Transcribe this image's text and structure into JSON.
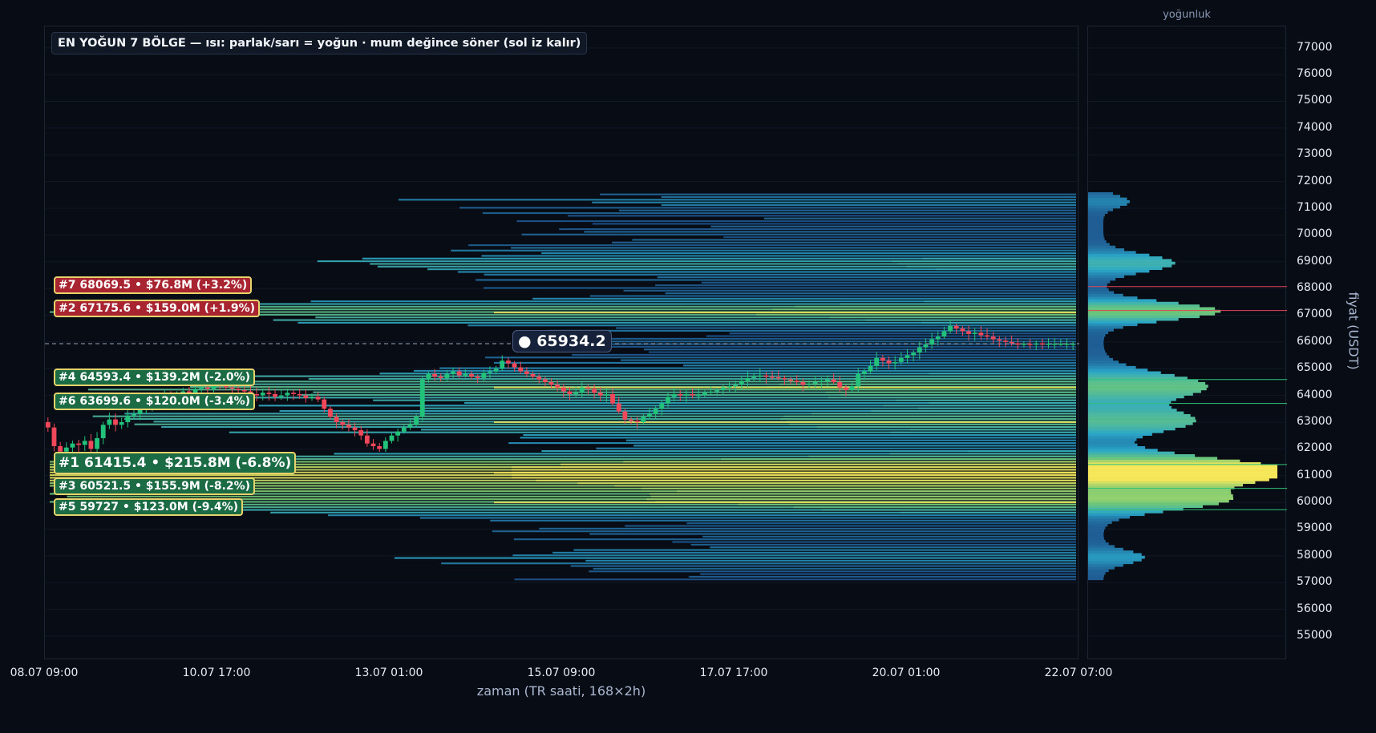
{
  "title": "EN YOĞUN 7 BÖLGE — ısı: parlak/sarı = yoğun · mum değince söner (sol iz kalır)",
  "current_price_label": "● 65934.2",
  "xlabel": "zaman (TR saati, 168×2h)",
  "ylabel": "fiyat (USDT)",
  "side_title": "yoğunluk",
  "x_ticks": [
    "08.07 09:00",
    "10.07 17:00",
    "13.07 01:00",
    "15.07 09:00",
    "17.07 17:00",
    "20.07 01:00",
    "22.07 07:00"
  ],
  "y_ticks": [
    "55000",
    "56000",
    "57000",
    "58000",
    "59000",
    "60000",
    "61000",
    "62000",
    "63000",
    "64000",
    "65000",
    "66000",
    "67000",
    "68000",
    "69000",
    "70000",
    "71000",
    "72000",
    "73000",
    "74000",
    "75000",
    "76000",
    "77000"
  ],
  "zones": [
    {
      "text": "#7  68069.5  •  $76.8M  (+3.2%)",
      "price": 68069.5,
      "color": "red"
    },
    {
      "text": "#2  67175.6  •  $159.0M  (+1.9%)",
      "price": 67175.6,
      "color": "red"
    },
    {
      "text": "#4  64593.4  •  $139.2M  (-2.0%)",
      "price": 64593.4,
      "color": "green"
    },
    {
      "text": "#6  63699.6  •  $120.0M  (-3.4%)",
      "price": 63699.6,
      "color": "green"
    },
    {
      "text": "#1  61415.4  •  $215.8M  (-6.8%)",
      "price": 61415.4,
      "color": "green",
      "big": true
    },
    {
      "text": "#3  60521.5  •  $155.9M  (-8.2%)",
      "price": 60521.5,
      "color": "green"
    },
    {
      "text": "#5  59727  •  $123.0M  (-9.4%)",
      "price": 59727,
      "color": "green"
    }
  ],
  "colors": {
    "background": "#080c14",
    "up": "#22c27a",
    "down": "#f0475a",
    "heat_low": "#1a3a7a",
    "heat_mid": "#2aa7c9",
    "heat_high": "#f5e65a",
    "zone_line_red": "#e0455a",
    "zone_line_green": "#2ec27a"
  },
  "chart_data": {
    "type": "heatmap",
    "current_price": 65934.2,
    "ylim": [
      54100,
      77800
    ],
    "x_range": [
      "08.07 09:00",
      "22.07 07:00"
    ],
    "bars": 168,
    "candle_closes": [
      62800,
      62100,
      61900,
      62050,
      62200,
      62150,
      62300,
      62000,
      62400,
      62900,
      63100,
      62900,
      63000,
      63250,
      63300,
      63500,
      63600,
      63700,
      63900,
      64000,
      63950,
      64050,
      64150,
      64100,
      64250,
      64300,
      64250,
      64400,
      64350,
      64300,
      64250,
      64200,
      64150,
      64050,
      64000,
      64100,
      64050,
      63950,
      64000,
      64100,
      64050,
      64000,
      63900,
      63950,
      63850,
      63500,
      63200,
      63000,
      62900,
      62800,
      62700,
      62500,
      62200,
      62100,
      62000,
      62300,
      62500,
      62650,
      62800,
      62900,
      63200,
      64600,
      64800,
      64700,
      64650,
      64800,
      64900,
      64750,
      64800,
      64700,
      64650,
      64850,
      64900,
      65000,
      65300,
      65200,
      65050,
      64900,
      64800,
      64700,
      64600,
      64500,
      64400,
      64300,
      64150,
      64050,
      64100,
      64300,
      64250,
      64100,
      64000,
      64050,
      63700,
      63400,
      63100,
      63050,
      63000,
      63200,
      63300,
      63500,
      63700,
      63950,
      64050,
      64000,
      64050,
      64000,
      64020,
      64100,
      64150,
      64200,
      64300,
      64350,
      64400,
      64550,
      64650,
      64700,
      64750,
      64700,
      64680,
      64650,
      64600,
      64550,
      64500,
      64400,
      64450,
      64500,
      64550,
      64600,
      64500,
      64300,
      64200,
      64350,
      64800,
      64900,
      65100,
      65400,
      65300,
      65200,
      65250,
      65400,
      65500,
      65600,
      65800,
      65900,
      66100,
      66200,
      66400,
      66600,
      66500,
      66400,
      66300,
      66350,
      66250,
      66200,
      66100,
      66050,
      66000,
      65950,
      65900,
      65934.2,
      65900,
      65950,
      65934.2,
      65934.2,
      65934.2,
      65934.2,
      65934.2,
      65934.2
    ],
    "profile": {
      "min_price": 57100,
      "max_price": 71500,
      "peaks": [
        {
          "price": 61100,
          "strength": 1.0,
          "width": 700
        },
        {
          "price": 67100,
          "strength": 0.62,
          "width": 450
        },
        {
          "price": 64300,
          "strength": 0.55,
          "width": 650
        },
        {
          "price": 60000,
          "strength": 0.58,
          "width": 500
        },
        {
          "price": 63000,
          "strength": 0.48,
          "width": 600
        },
        {
          "price": 68900,
          "strength": 0.38,
          "width": 450
        },
        {
          "price": 57900,
          "strength": 0.22,
          "width": 350
        },
        {
          "price": 71200,
          "strength": 0.14,
          "width": 300
        }
      ]
    }
  }
}
